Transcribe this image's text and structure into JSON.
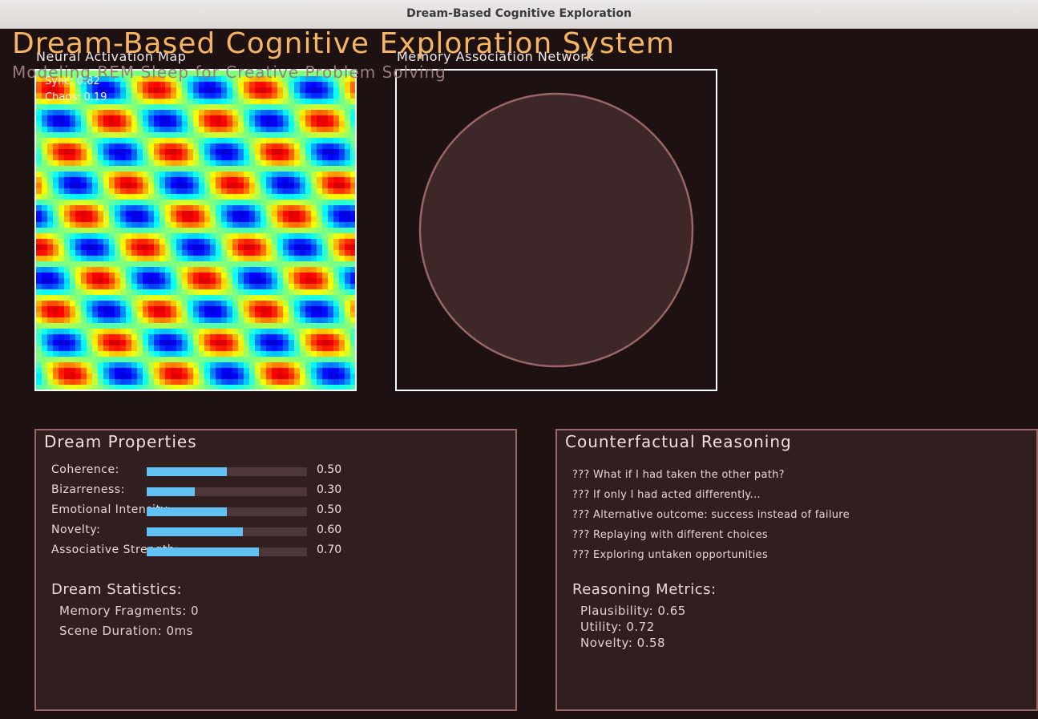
{
  "window": {
    "title": "Dream-Based Cognitive Exploration"
  },
  "header": {
    "title": "Dream-Based Cognitive Exploration System",
    "subtitle": "Modeling REM Sleep for Creative Problem Solving"
  },
  "neural_map": {
    "label": "Neural Activation Map",
    "sync": "Sync: 0.82",
    "chaos": "Chaos: 0.19",
    "colormap": "jet"
  },
  "memory_network": {
    "label": "Memory Association Network",
    "circle_fill": "#3d2729",
    "circle_stroke": "#9a6566"
  },
  "dream_properties": {
    "title": "Dream Properties",
    "items": [
      {
        "label": "Coherence:",
        "value": "0.50",
        "fraction": 0.5
      },
      {
        "label": "Bizarreness:",
        "value": "0.30",
        "fraction": 0.3
      },
      {
        "label": "Emotional Intensity:",
        "value": "0.50",
        "fraction": 0.5
      },
      {
        "label": "Novelty:",
        "value": "0.60",
        "fraction": 0.6
      },
      {
        "label": "Associative Strength:",
        "value": "0.70",
        "fraction": 0.7
      }
    ],
    "stats_title": "Dream Statistics:",
    "stats": [
      "Memory Fragments: 0",
      "Scene Duration: 0ms"
    ]
  },
  "counterfactual": {
    "title": "Counterfactual Reasoning",
    "lines": [
      "??? What if I had taken the other path?",
      "??? If only I had acted differently...",
      "??? Alternative outcome: success instead of failure",
      "??? Replaying with different choices",
      "??? Exploring untaken opportunities"
    ],
    "metrics_title": "Reasoning Metrics:",
    "metrics": [
      "Plausibility: 0.65",
      "Utility: 0.72",
      "Novelty: 0.58"
    ]
  },
  "colors": {
    "background": "#1e1111",
    "title": "#f5b562",
    "panel_fill": "#311e1f",
    "panel_border": "#9a6667",
    "bar_fill": "#62c1f3",
    "bar_track": "#4d3738"
  }
}
